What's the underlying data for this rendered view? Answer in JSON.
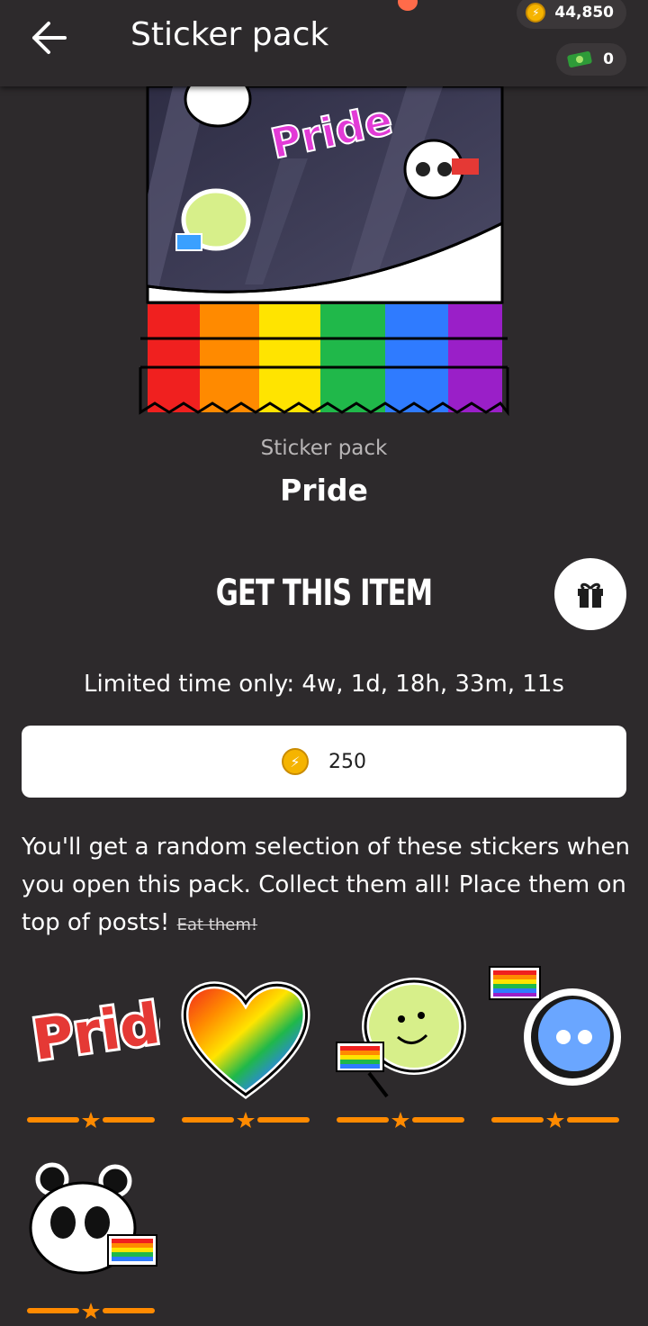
{
  "appbar": {
    "title": "Sticker pack",
    "coins": "44,850",
    "cash": "0"
  },
  "pack": {
    "sticker_text": "Pride"
  },
  "item": {
    "type": "Sticker pack",
    "name": "Pride"
  },
  "get": {
    "title": "GET THIS ITEM",
    "timer": "Limited time only: 4w, 1d, 18h, 33m, 11s",
    "price": "250"
  },
  "description": {
    "text": "You'll get a random selection of these stickers when you open this pack. Collect them all! Place them on top of posts! ",
    "struck": "Eat them!"
  },
  "stickers": [
    {
      "name": "pride-text-sticker",
      "text": "Pride",
      "rarity_stars": 1
    },
    {
      "name": "rainbow-heart-sticker",
      "rarity_stars": 1
    },
    {
      "name": "frog-hand-flag-sticker",
      "rarity_stars": 1
    },
    {
      "name": "ghost-flag-sticker",
      "rarity_stars": 1
    },
    {
      "name": "panda-flag-sticker",
      "rarity_stars": 1
    }
  ],
  "colors": {
    "background": "#2d2a2c",
    "rarity": "#ff8a00",
    "coin": "#f5b400"
  }
}
